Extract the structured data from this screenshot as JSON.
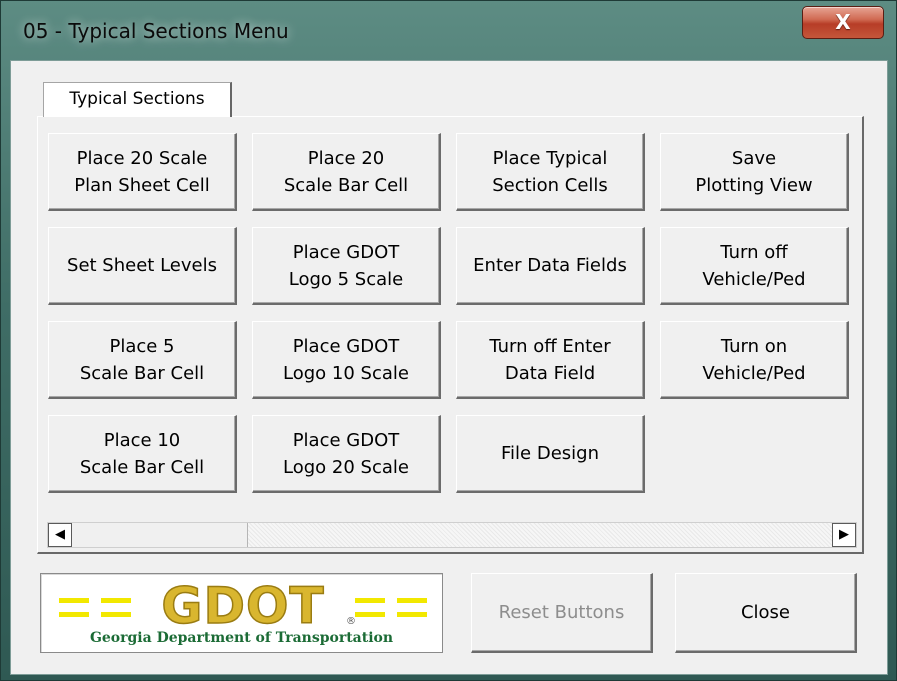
{
  "window": {
    "title": "05 - Typical Sections Menu",
    "close_glyph": "X"
  },
  "tabs": [
    {
      "label": "Typical Sections"
    }
  ],
  "buttons": [
    {
      "label": "Place 20 Scale\nPlan Sheet Cell"
    },
    {
      "label": "Place 20\nScale Bar Cell"
    },
    {
      "label": "Place Typical\nSection Cells"
    },
    {
      "label": "Save\nPlotting View"
    },
    {
      "label": "Set Sheet Levels"
    },
    {
      "label": "Place GDOT\nLogo 5 Scale"
    },
    {
      "label": "Enter Data Fields"
    },
    {
      "label": "Turn off\nVehicle/Ped"
    },
    {
      "label": "Place 5\nScale Bar Cell"
    },
    {
      "label": "Place GDOT\nLogo 10 Scale"
    },
    {
      "label": "Turn off Enter\nData Field"
    },
    {
      "label": "Turn on\nVehicle/Ped"
    },
    {
      "label": "Place 10\nScale Bar Cell"
    },
    {
      "label": "Place GDOT\nLogo 20 Scale"
    },
    {
      "label": "File Design"
    }
  ],
  "scrollbar": {
    "left_arrow": "◀",
    "right_arrow": "▶"
  },
  "logo": {
    "text": "GDOT",
    "registered": "®",
    "caption": "Georgia Department of Transportation",
    "colors": {
      "gold": "#d9b62f",
      "yellow": "#f2e800",
      "green": "#1b6b35"
    }
  },
  "footer": {
    "reset_label": "Reset Buttons",
    "reset_enabled": false,
    "close_label": "Close"
  }
}
